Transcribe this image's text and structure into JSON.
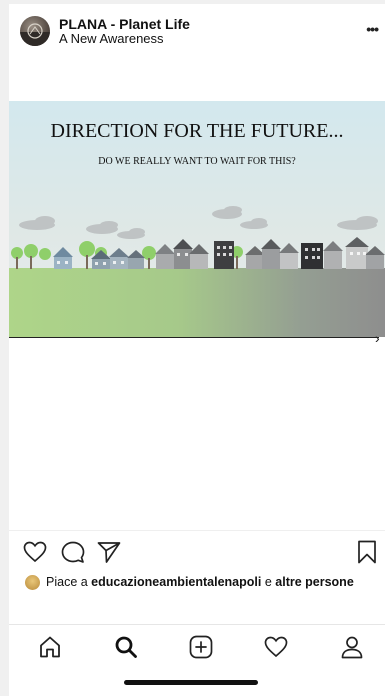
{
  "header": {
    "account_name": "PLANA - Planet Life",
    "account_subtitle": "A New Awareness",
    "more_glyph": "•••",
    "avatar_icon": "account-avatar"
  },
  "post": {
    "image_title": "DIRECTION FOR THE FUTURE...",
    "image_subtitle": "DO WE REALLY WANT TO WAIT FOR THIS?",
    "next_glyph": "›",
    "colors": {
      "sky": "#d3e8ee",
      "grass": "#aed589",
      "concrete": "#8e8e8e"
    }
  },
  "actions": {
    "like_icon": "heart-icon",
    "comment_icon": "comment-icon",
    "share_icon": "send-icon",
    "save_icon": "bookmark-icon"
  },
  "likes": {
    "prefix": "Piace a ",
    "user": "educazioneambientalenapoli",
    "middle": " e ",
    "suffix": "altre persone"
  },
  "nav": {
    "items": [
      "home-icon",
      "search-icon",
      "new-post-icon",
      "activity-icon",
      "profile-icon"
    ]
  }
}
